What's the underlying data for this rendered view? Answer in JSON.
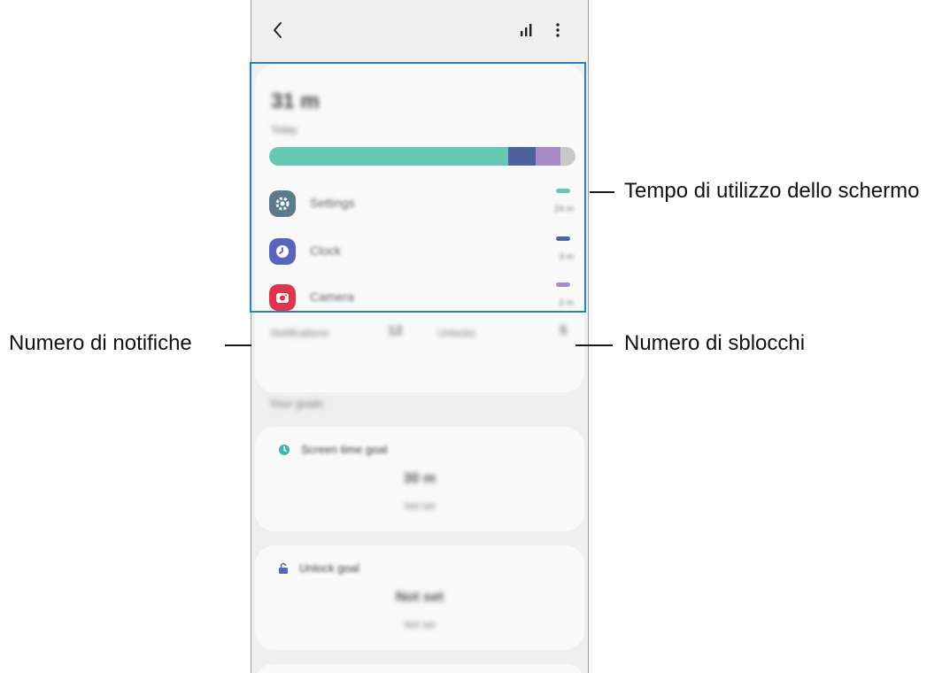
{
  "appbar": {
    "back_icon": "chevron-left-icon",
    "stats_icon": "bar-chart-icon",
    "more_icon": "more-vert-icon"
  },
  "usage": {
    "total_time": "31 m",
    "date": "Today",
    "bar_segments": [
      {
        "name": "Settings",
        "color": "#66c7b4",
        "fraction": 0.78
      },
      {
        "name": "Clock",
        "color": "#4e629e",
        "fraction": 0.09
      },
      {
        "name": "Camera",
        "color": "#a58ac6",
        "fraction": 0.08
      },
      {
        "name": "Other",
        "color": "#c8c8c8",
        "fraction": 0.05
      }
    ],
    "apps": [
      {
        "name": "Settings",
        "time": "24 m",
        "icon": "gear-icon",
        "icon_bg": "#5b7a8a",
        "dash_color": "#66c7b4"
      },
      {
        "name": "Clock",
        "time": "3 m",
        "icon": "clock-icon",
        "icon_bg": "#5a64c0",
        "dash_color": "#4e629e"
      },
      {
        "name": "Camera",
        "time": "2 m",
        "icon": "camera-icon",
        "icon_bg": "#e0334e",
        "dash_color": "#a58ac6"
      }
    ],
    "notifications_label": "Notifications",
    "notifications_count": "12",
    "unlocks_label": "Unlocks",
    "unlocks_count": "5"
  },
  "goals": {
    "section_title": "Your goals",
    "screen_goal": {
      "title": "Screen time goal",
      "value": "30 m",
      "sub": "Not set"
    },
    "unlock_goal": {
      "title": "Unlock goal",
      "value": "Not set",
      "sub": "Not set"
    }
  },
  "callouts": {
    "screen_time": "Tempo di utilizzo dello schermo",
    "notifications": "Numero di notifiche",
    "unlocks": "Numero di sblocchi"
  },
  "colors": {
    "highlight": "#2b7fc0",
    "screen_bg": "#efefef",
    "card_bg": "#f9f9f9"
  }
}
